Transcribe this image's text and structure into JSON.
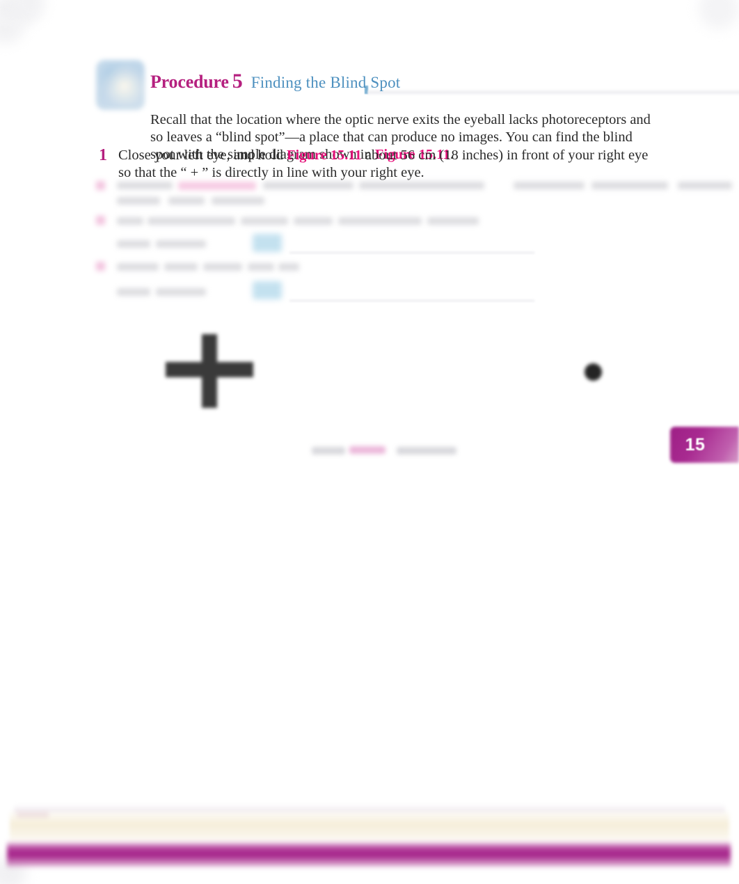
{
  "document": {
    "page_number": "15",
    "chapter_tab_label": "15"
  },
  "header": {
    "procedure_word": "Procedure",
    "procedure_number": "5",
    "procedure_subtitle": "Finding the Blind Spot",
    "icon_name": "microscope-lab-icon"
  },
  "intro": {
    "paragraph_part1": "Recall that the location where the optic nerve exits the eyeball lacks photoreceptors and so leaves a “blind spot”—a place that can produce no images. You can find the blind spot with the simple diagram shown in ",
    "figure_reference": "Figure 15.11",
    "paragraph_part2": "."
  },
  "steps": [
    {
      "number": "1",
      "text_part1": "Close your left eye, and hold ",
      "figure_reference": "Figure 15.11",
      "text_part2": " about 56 cm (18 inches) in front of your right eye so that the “ + ” is directly in line with your right eye."
    },
    {
      "number": "2",
      "state": "obscured",
      "note": "text illegible in source image"
    },
    {
      "number": "3",
      "state": "obscured",
      "note": "text illegible in source image"
    },
    {
      "number": "4",
      "state": "obscured",
      "note": "text illegible in source image"
    }
  ],
  "figure": {
    "name": "blind-spot-test-figure",
    "cross_symbol": "+",
    "dot_symbol": "●",
    "caption_state": "obscured"
  },
  "colors": {
    "magenta": "#b5207f",
    "figure_reference_pink": "#e5117a",
    "subtitle_blue": "#4d90bf",
    "body_text": "#2a2a2a",
    "band_cream": "#f5edd8",
    "band_magenta": "#a8258c",
    "fill_box_blue": "#b9dced"
  }
}
